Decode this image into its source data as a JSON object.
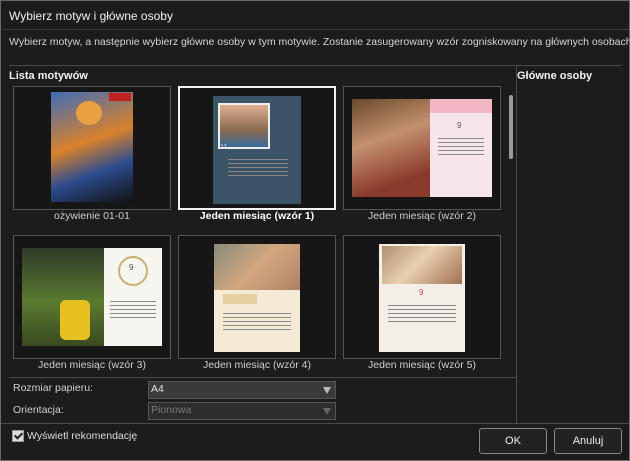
{
  "window": {
    "title": "Wybierz motyw i główne osoby",
    "description": "Wybierz motyw, a następnie wybierz główne osoby w tym motywie. Zostanie zasugerowany wzór zogniskowany na głównych osobach."
  },
  "themes": {
    "label": "Lista motywów",
    "items": [
      {
        "caption": "ożywienie 01-01",
        "selected": false
      },
      {
        "caption": "Jeden miesiąc (wzór 1)",
        "selected": true
      },
      {
        "caption": "Jeden miesiąc (wzór 2)",
        "selected": false
      },
      {
        "caption": "Jeden miesiąc (wzór 3)",
        "selected": false
      },
      {
        "caption": "Jeden miesiąc (wzór 4)",
        "selected": false
      },
      {
        "caption": "Jeden miesiąc (wzór 5)",
        "selected": false
      }
    ]
  },
  "main_people": {
    "label": "Główne osoby"
  },
  "paper": {
    "label": "Rozmiar papieru:",
    "value": "A4"
  },
  "orientation": {
    "label": "Orientacja:",
    "value": "Pionowa"
  },
  "recommend": {
    "label": "Wyświetl rekomendację",
    "checked": true
  },
  "buttons": {
    "ok": "OK",
    "cancel": "Anuluj"
  },
  "thumbs": {
    "calendar_day": "9",
    "calendar_number_alt": "11"
  }
}
